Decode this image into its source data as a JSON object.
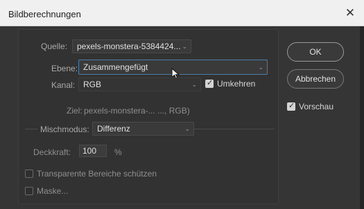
{
  "window": {
    "title": "Bildberechnungen",
    "close_glyph": "✕"
  },
  "source": {
    "label": "Quelle:",
    "value": "pexels-monstera-5384424...",
    "layer_label": "Ebene:",
    "layer_value": "Zusammengefügt",
    "channel_label": "Kanal:",
    "channel_value": "RGB",
    "invert_label": "Umkehren",
    "invert_checked": true
  },
  "target": {
    "label": "Ziel:",
    "value": "pexels-monstera-... ..., RGB)"
  },
  "blend": {
    "mode_label": "Mischmodus:",
    "mode_value": "Differenz",
    "opacity_label": "Deckkraft:",
    "opacity_value": "100",
    "opacity_unit": "%",
    "preserve_label": "Transparente Bereiche schützen",
    "preserve_checked": false,
    "mask_label": "Maske...",
    "mask_checked": false
  },
  "buttons": {
    "ok_label": "OK",
    "cancel_label": "Abbrechen"
  },
  "preview": {
    "label": "Vorschau",
    "checked": true
  },
  "colors": {
    "dialog_bg": "#353535",
    "titlebar_bg": "#f0f0f0",
    "focus_border": "#4b7ea8"
  }
}
